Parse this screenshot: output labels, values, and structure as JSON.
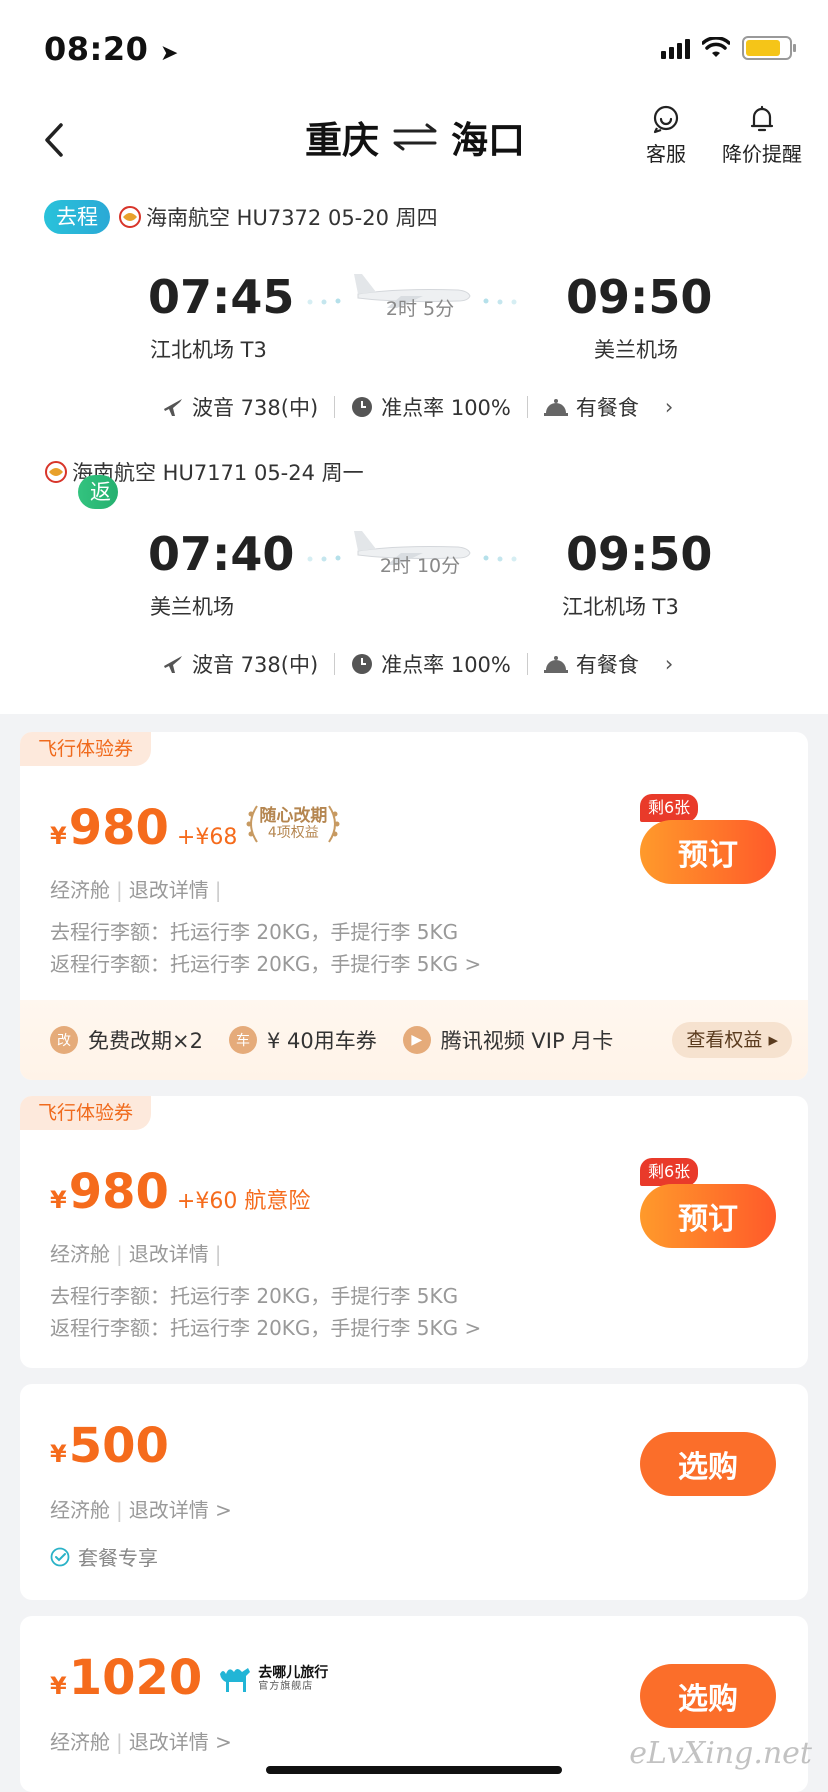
{
  "status_bar": {
    "time": "08:20"
  },
  "header": {
    "from_city": "重庆",
    "to_city": "海口",
    "service_label": "客服",
    "price_alert_label": "降价提醒"
  },
  "outbound": {
    "badge": "去程",
    "airline_line": "海南航空 HU7372  05-20 周四",
    "dep_time": "07:45",
    "dep_airport": "江北机场 T3",
    "duration": "2时 5分",
    "arr_time": "09:50",
    "arr_airport": "美兰机场",
    "aircraft": "波音 738(中)",
    "ontime": "准点率 100%",
    "meal": "有餐食"
  },
  "return": {
    "badge": "返程",
    "airline_line": "海南航空 HU7171  05-24 周一",
    "dep_time": "07:40",
    "dep_airport": "美兰机场",
    "duration": "2时 10分",
    "arr_time": "09:50",
    "arr_airport": "江北机场 T3",
    "aircraft": "波音 738(中)",
    "ontime": "准点率 100%",
    "meal": "有餐食"
  },
  "offers": [
    {
      "tag": "飞行体验券",
      "yen": "¥",
      "price": "980",
      "addon": "+¥68",
      "laurel_line1": "随心改期",
      "laurel_line2": "4项权益",
      "cabin": "经济舱",
      "refund": "退改详情",
      "baggage_out": "去程行李额：托运行李 20KG，手提行李 5KG",
      "baggage_ret": "返程行李额：托运行李 20KG，手提行李 5KG >",
      "remain": "剩6张",
      "button": "预订",
      "perks": [
        {
          "icon_text": "改",
          "label": "免费改期×2"
        },
        {
          "icon_text": "车",
          "label": "¥ 40用车券"
        },
        {
          "icon_text": "▶",
          "label": "腾讯视频 VIP 月卡"
        }
      ],
      "perk_button": "查看权益 ▸"
    },
    {
      "tag": "飞行体验券",
      "yen": "¥",
      "price": "980",
      "addon": "+¥60 航意险",
      "cabin": "经济舱",
      "refund": "退改详情",
      "baggage_out": "去程行李额：托运行李 20KG，手提行李 5KG",
      "baggage_ret": "返程行李额：托运行李 20KG，手提行李 5KG >",
      "remain": "剩6张",
      "button": "预订"
    },
    {
      "yen": "¥",
      "price": "500",
      "cabin": "经济舱",
      "refund": "退改详情 >",
      "package": "套餐专享",
      "button": "选购"
    },
    {
      "yen": "¥",
      "price": "1020",
      "brand_line1": "去哪儿旅行",
      "brand_line2": "官方旗舰店",
      "cabin": "经济舱",
      "refund": "退改详情 >",
      "button": "选购"
    }
  ],
  "watermark": "eLvXing.net",
  "colors": {
    "accent": "#f56b1c",
    "button": "#fb6e2a",
    "go_badge": "#29c2da",
    "return_badge": "#33c37f"
  }
}
